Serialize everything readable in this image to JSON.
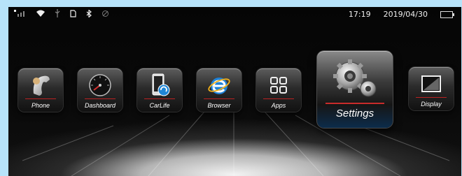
{
  "status": {
    "time": "17:19",
    "date": "2019/04/30",
    "icons": [
      "signal-icon",
      "wifi-icon",
      "usb-icon",
      "sim-icon",
      "bluetooth-icon",
      "gps-icon",
      "battery-icon"
    ]
  },
  "apps": [
    {
      "label": "Phone",
      "icon": "phone-icon"
    },
    {
      "label": "Dashboard",
      "icon": "speedometer-icon"
    },
    {
      "label": "CarLife",
      "icon": "carlife-icon"
    },
    {
      "label": "Browser",
      "icon": "browser-icon"
    },
    {
      "label": "Apps",
      "icon": "apps-grid-icon"
    },
    {
      "label": "Settings",
      "icon": "gear-icon",
      "selected": true
    },
    {
      "label": "Display",
      "icon": "display-icon"
    }
  ],
  "colors": {
    "accent_red": "#c82b2b",
    "frame_blue": "#b7e3f9",
    "browser_blue": "#1e82d8"
  }
}
